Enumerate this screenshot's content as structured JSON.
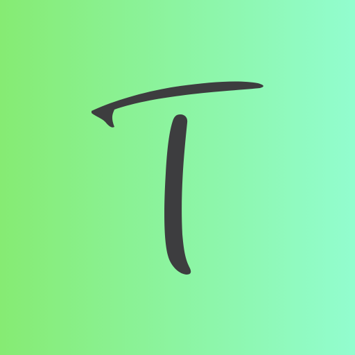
{
  "icon": {
    "name": "letter-t-icon",
    "letter": "T",
    "colors": {
      "gradient_start": "#86eb73",
      "gradient_end": "#92fdcf",
      "glyph": "#3d3d3f"
    }
  }
}
